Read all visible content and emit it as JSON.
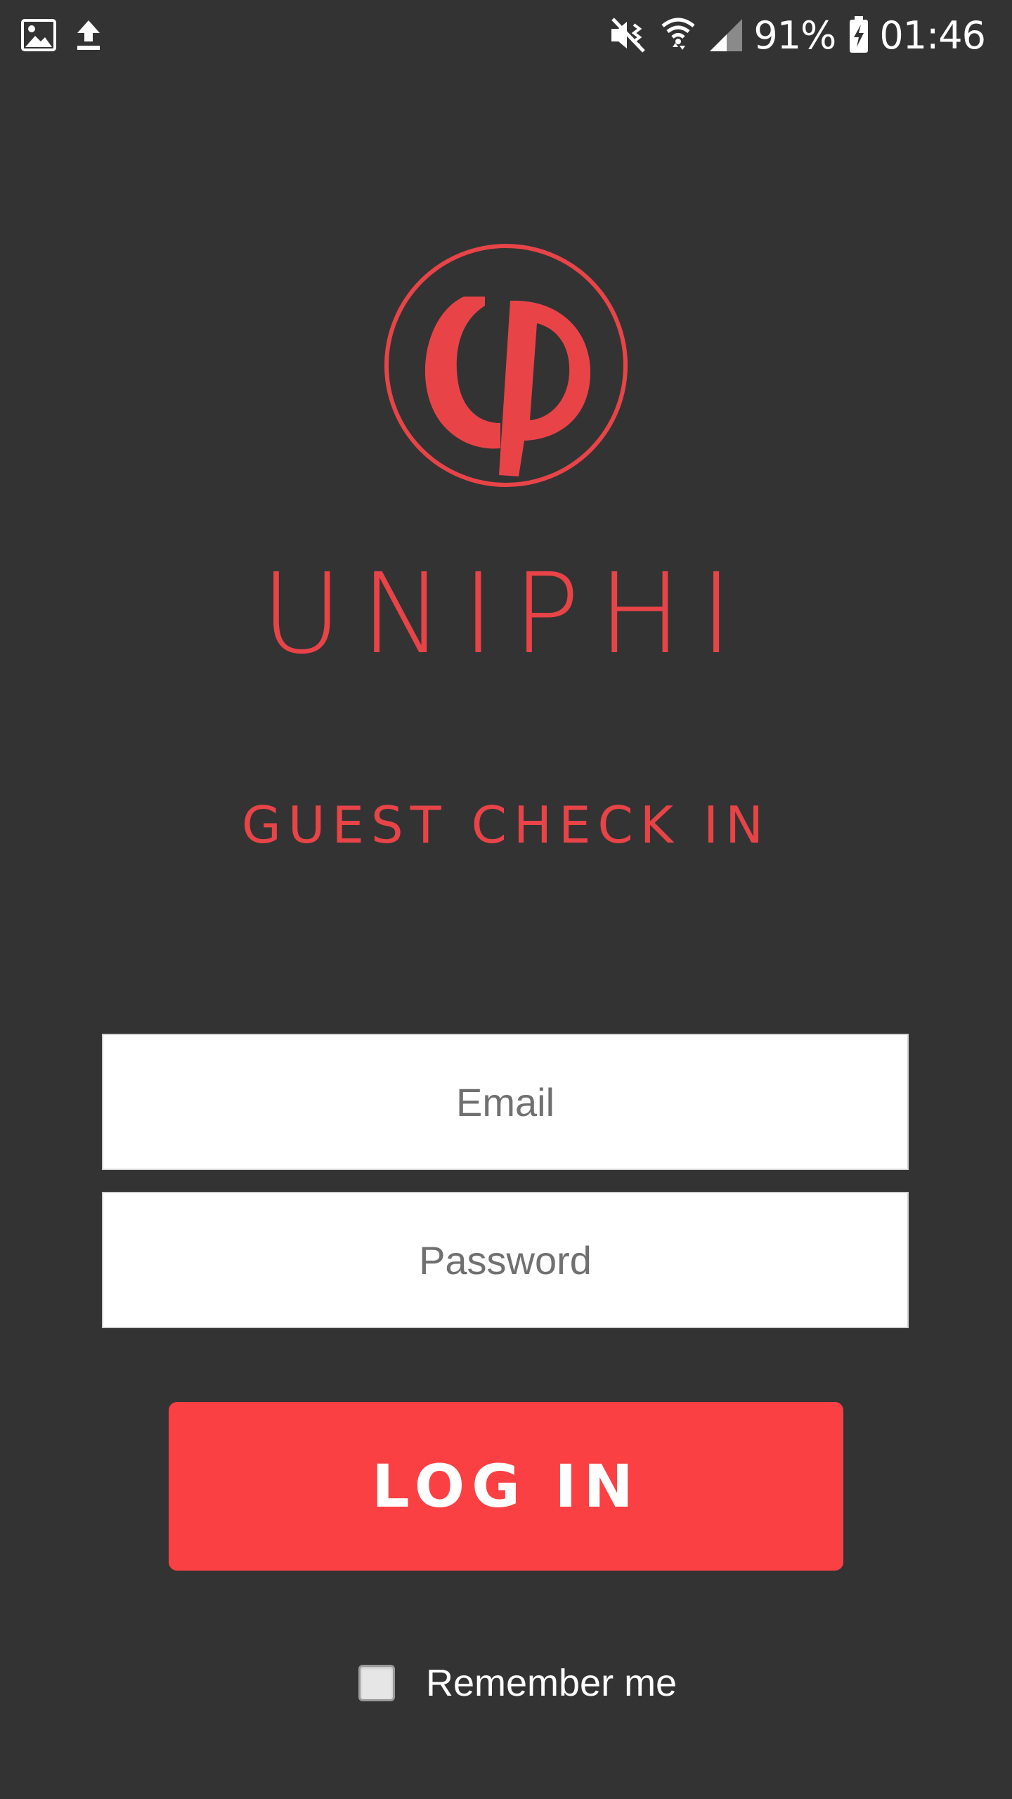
{
  "status_bar": {
    "left_icons": [
      "image-icon",
      "upload-icon"
    ],
    "right_icons": [
      "vibrate-mute-icon",
      "wifi-icon",
      "cell-signal-icon",
      "battery-charging-icon"
    ],
    "battery_percent": "91%",
    "time": "01:46"
  },
  "brand": {
    "logo_icon": "uniphi-logo-icon",
    "name": "UNIPHI",
    "subtitle": "GUEST CHECK IN",
    "accent_color": "#e84448"
  },
  "form": {
    "email": {
      "value": "",
      "placeholder": "Email"
    },
    "password": {
      "value": "",
      "placeholder": "Password"
    },
    "login_label": "LOG IN",
    "button_color": "#fb4044",
    "remember_label": "Remember me",
    "remember_checked": false
  },
  "colors": {
    "background": "#333333"
  }
}
